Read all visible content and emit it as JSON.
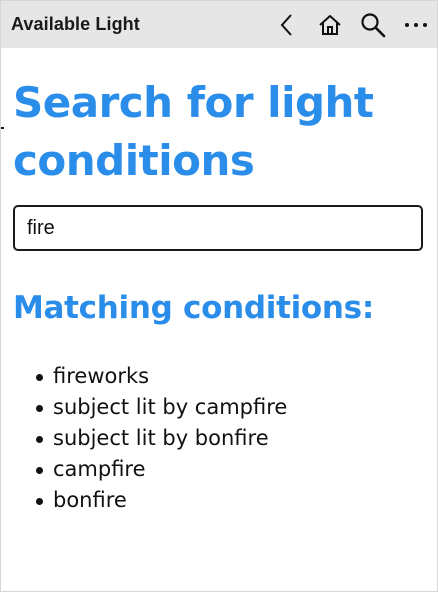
{
  "window": {
    "title": "Available Light"
  },
  "toolbar": {
    "back_icon": "chevron-left-icon",
    "home_icon": "home-icon",
    "search_icon": "search-icon",
    "more_icon": "more-horizontal-icon"
  },
  "page": {
    "title": "Search for light conditions",
    "search": {
      "value": "fire",
      "placeholder": ""
    },
    "results_heading": "Matching conditions:",
    "results": [
      "fireworks",
      "subject lit by campfire",
      "subject lit by bonfire",
      "campfire",
      "bonfire"
    ]
  },
  "colors": {
    "accent": "#2a8dea",
    "topbar_bg": "#e6e6e6",
    "text": "#111111"
  }
}
